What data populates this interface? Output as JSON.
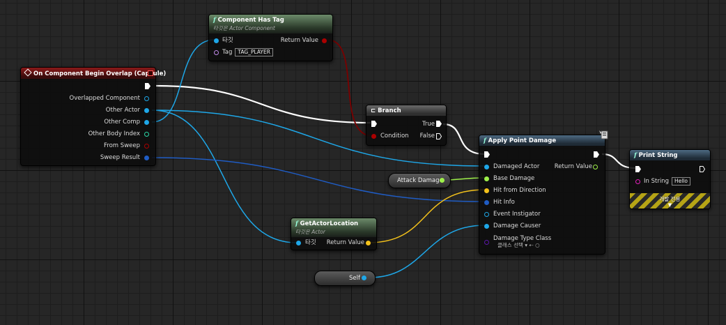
{
  "nodes": {
    "event": {
      "title": "On Component Begin Overlap (Capsule)",
      "pins": {
        "overlapped_component": "Overlapped Component",
        "other_actor": "Other Actor",
        "other_comp": "Other Comp",
        "other_body_index": "Other Body Index",
        "from_sweep": "From Sweep",
        "sweep_result": "Sweep Result"
      }
    },
    "has_tag": {
      "title": "Component Has Tag",
      "subtitle": "타깃은 Actor Component",
      "target": "타깃",
      "tag_label": "Tag",
      "tag_value": "TAG_PLAYER",
      "return_value": "Return Value"
    },
    "branch": {
      "title": "Branch",
      "condition": "Condition",
      "true_label": "True",
      "false_label": "False"
    },
    "apply_damage": {
      "title": "Apply Point Damage",
      "pins": {
        "damaged_actor": "Damaged Actor",
        "base_damage": "Base Damage",
        "hit_from_direction": "Hit from Direction",
        "hit_info": "Hit Info",
        "event_instigator": "Event Instigator",
        "damage_causer": "Damage Causer",
        "damage_type_class": "Damage Type Class"
      },
      "class_select": "클래스 선택",
      "return_value": "Return Value"
    },
    "print_string": {
      "title": "Print String",
      "in_string_label": "In String",
      "in_string_value": "Hello",
      "dev_only": "개발 전용"
    },
    "get_location": {
      "title": "GetActorLocation",
      "subtitle": "타깃은 Actor",
      "target": "타깃",
      "return_value": "Return Value"
    },
    "attack_damage": {
      "label": "Attack Damage"
    },
    "self": {
      "label": "Self"
    }
  },
  "colors": {
    "exec": "#ffffff",
    "object": "#1ea7e8",
    "bool": "#8b0000",
    "float": "#9ef04a",
    "vector": "#f4c21b",
    "struct": "#1f5cc4",
    "name": "#c08ae8",
    "int": "#2ad6a6",
    "class": "#5b16a8"
  }
}
